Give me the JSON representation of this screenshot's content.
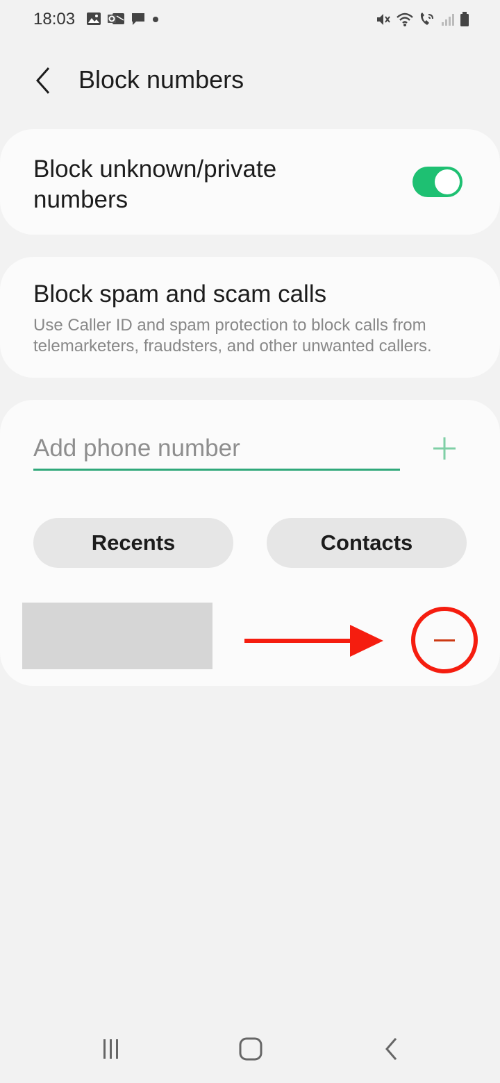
{
  "status_bar": {
    "time": "18:03",
    "left_icons": [
      "gallery-icon",
      "outlook-icon",
      "message-icon",
      "dot-icon"
    ],
    "right_icons": [
      "mute-icon",
      "wifi-icon",
      "wifi-calling-icon",
      "signal-icon",
      "battery-icon"
    ]
  },
  "header": {
    "title": "Block numbers",
    "back_icon": "chevron-left-icon"
  },
  "toggle_card": {
    "label": "Block unknown/private numbers",
    "enabled": true,
    "accent_color": "#1ec072"
  },
  "spam_card": {
    "title": "Block spam and scam calls",
    "description": "Use Caller ID and spam protection to block calls from telemarketers, fraudsters, and other unwanted callers."
  },
  "add_card": {
    "input_placeholder": "Add phone number",
    "input_value": "",
    "add_icon": "plus-icon",
    "recents_label": "Recents",
    "contacts_label": "Contacts",
    "blocked_entry": {
      "number_redacted": true,
      "remove_icon": "minus-circle-icon",
      "highlight_color": "#f51d0f"
    }
  },
  "nav_bar": {
    "items": [
      "recent-apps-icon",
      "home-icon",
      "back-icon"
    ]
  }
}
